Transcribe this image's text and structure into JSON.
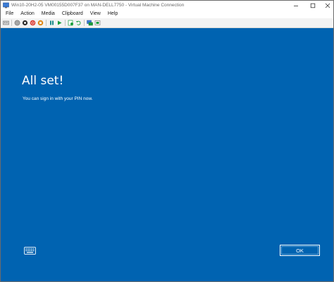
{
  "window": {
    "title": "Win10-20H2-05 VM00155D007F37 on MAN-DELL7750 - Virtual Machine Connection",
    "controls": {
      "minimize": "—",
      "maximize": "☐",
      "close": "✕"
    }
  },
  "menubar": {
    "items": [
      "File",
      "Action",
      "Media",
      "Clipboard",
      "View",
      "Help"
    ]
  },
  "toolbar": {
    "icons": [
      "ctrl-alt-del-icon",
      "start-icon",
      "turn-off-icon",
      "shut-down-icon",
      "save-icon",
      "pause-icon",
      "reset-icon",
      "checkpoint-icon",
      "revert-icon",
      "enhanced-session-icon",
      "share-icon"
    ],
    "colors": {
      "green": "#1b9e3c",
      "red": "#d9342b",
      "orange": "#e08a1e",
      "teal": "#1a8a8a",
      "gray": "#6a6a6a"
    }
  },
  "screen": {
    "heading": "All set!",
    "message": "You can sign in with your PIN now.",
    "ok_label": "OK",
    "background": "#0063b1"
  }
}
